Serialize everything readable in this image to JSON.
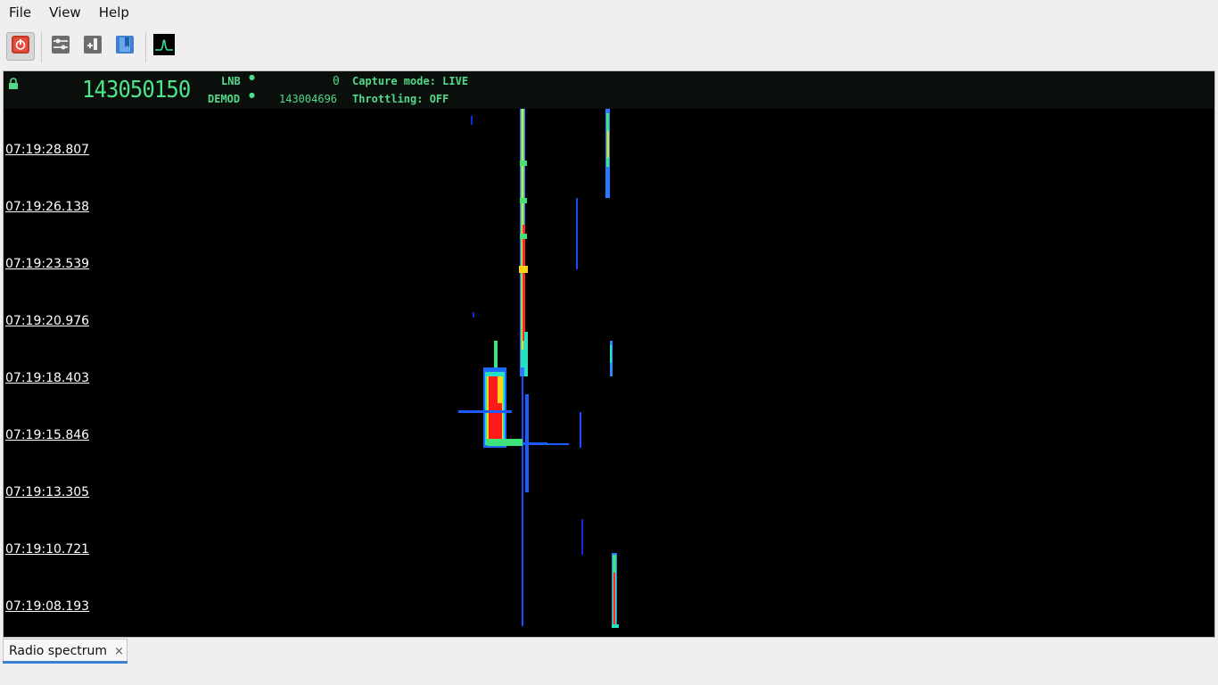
{
  "menu": {
    "file": "File",
    "view": "View",
    "help": "Help"
  },
  "toolbar": {
    "icons": [
      "power-icon",
      "settings-icon",
      "add-source-icon",
      "bookmark-icon",
      "spectrum-icon"
    ]
  },
  "header": {
    "center_frequency": "143050150",
    "lnb_label": "LNB",
    "lnb_value": "0",
    "demod_label": "DEMOD",
    "demod_value": "143004696",
    "capture_mode": "Capture mode: LIVE",
    "throttling": "Throttling: OFF"
  },
  "waterfall": {
    "timestamps": [
      "07:19:28.807",
      "07:19:26.138",
      "07:19:23.539",
      "07:19:20.976",
      "07:19:18.403",
      "07:19:15.846",
      "07:19:13.305",
      "07:19:10.721",
      "07:19:08.193"
    ]
  },
  "tabs": [
    {
      "label": "Radio spectrum",
      "close": "×"
    }
  ],
  "colors": {
    "display_green": "#52d98a",
    "waterfall_bg": "#000000",
    "tab_accent": "#3b82d6"
  }
}
